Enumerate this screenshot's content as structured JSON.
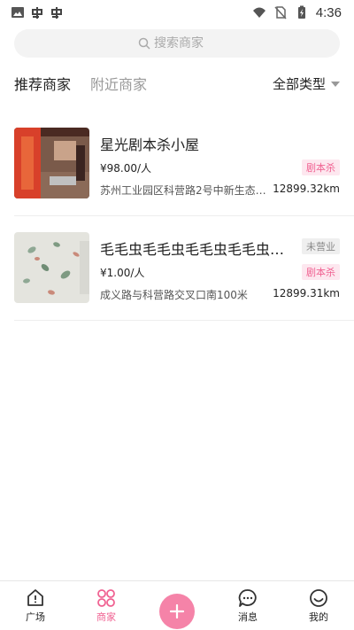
{
  "status_bar": {
    "time": "4:36"
  },
  "search": {
    "placeholder": "搜索商家"
  },
  "tabs": [
    {
      "label": "推荐商家",
      "active": true
    },
    {
      "label": "附近商家",
      "active": false
    }
  ],
  "filter": {
    "label": "全部类型"
  },
  "merchants": [
    {
      "name": "星光剧本杀小屋",
      "price": "¥98.00/人",
      "category_tag": "剧本杀",
      "address": "苏州工业园区科营路2号中新生态大...",
      "distance": "12899.32km"
    },
    {
      "name": "毛毛虫毛毛虫毛毛虫毛毛虫毛...",
      "status_tag": "未营业",
      "price": "¥1.00/人",
      "category_tag": "剧本杀",
      "address": "成义路与科营路交叉口南100米",
      "distance": "12899.31km"
    }
  ],
  "bottom_nav": [
    {
      "label": "广场",
      "icon": "home-icon"
    },
    {
      "label": "商家",
      "icon": "merchant-icon",
      "active": true
    },
    {
      "icon": "plus-icon"
    },
    {
      "label": "消息",
      "icon": "message-icon"
    },
    {
      "label": "我的",
      "icon": "profile-icon"
    }
  ],
  "colors": {
    "accent": "#f06292",
    "fab": "#f583a8",
    "tag_bg": "#fde7ef"
  }
}
